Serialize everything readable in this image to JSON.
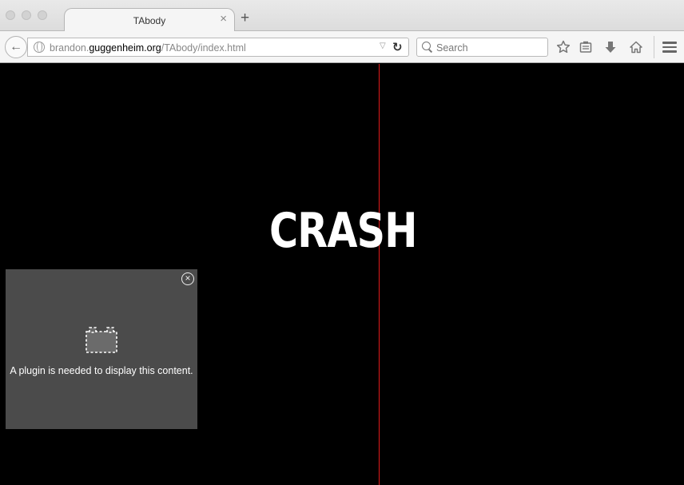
{
  "window": {
    "tab_title": "TAbody",
    "tab_close_glyph": "×",
    "new_tab_glyph": "+"
  },
  "navbar": {
    "back_glyph": "←",
    "url_prefix": "brandon.",
    "url_host": "guggenheim.org",
    "url_path": "/TAbody/index.html",
    "dropmarker_glyph": "▽",
    "reload_glyph": "↻",
    "search_placeholder": "Search",
    "icons": [
      "bookmark-star-icon",
      "reading-list-icon",
      "downloads-icon",
      "home-icon",
      "menu-icon"
    ]
  },
  "page": {
    "heading": "CRASH",
    "accent_line_color": "#e21b1b",
    "background_color": "#000000"
  },
  "plugin": {
    "message": "A plugin is needed to display this content.",
    "close_glyph": "×",
    "background_color": "#4b4b4b"
  }
}
